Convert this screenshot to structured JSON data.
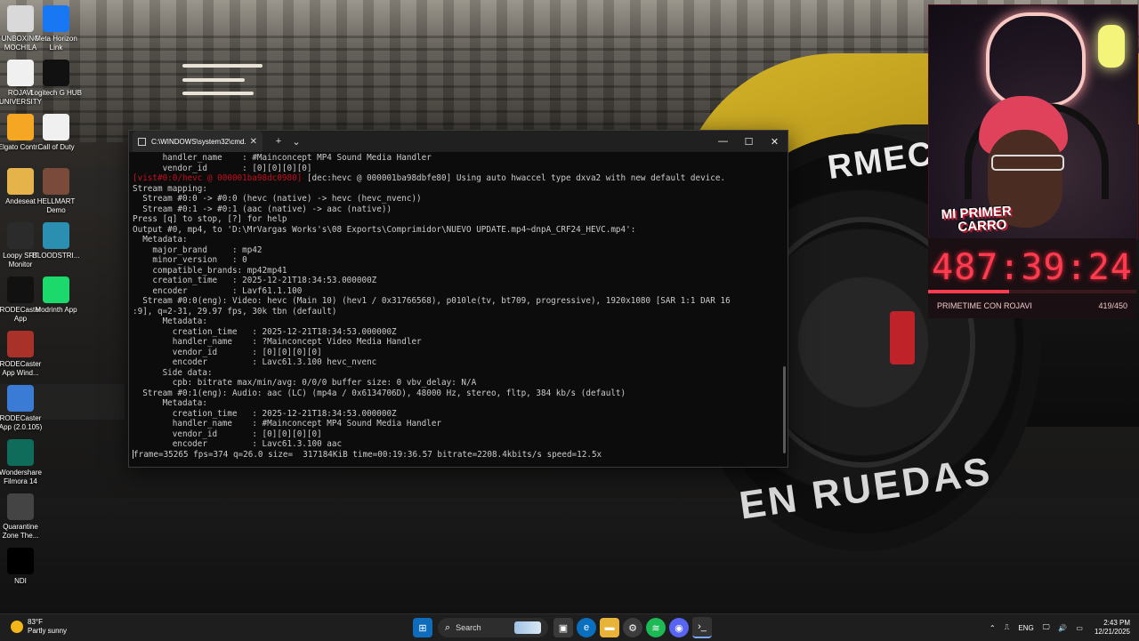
{
  "desktop_icons": [
    {
      "label": "UNBOXING MOCHILA",
      "icon": "folder-icon",
      "color": "#d9d9d9"
    },
    {
      "label": "Meta Horizon Link",
      "icon": "meta-icon",
      "color": "#1877f2"
    },
    {
      "label": "ROJAVI UNIVERSITY",
      "icon": "document-icon",
      "color": "#f0f0f0"
    },
    {
      "label": "Logitech G HUB",
      "icon": "logitech-icon",
      "color": "#111111"
    },
    {
      "label": "Elgato Contr...",
      "icon": "elgato-icon",
      "color": "#f5a623"
    },
    {
      "label": "Call of Duty",
      "icon": "document-icon",
      "color": "#f0f0f0"
    },
    {
      "label": "Andeseat",
      "icon": "folder-icon",
      "color": "#e6b34a"
    },
    {
      "label": "HELLMART Demo",
      "icon": "game-icon",
      "color": "#7a4a3a"
    },
    {
      "label": "Loopy SRT Monitor",
      "icon": "srt-icon",
      "color": "#2b2b2b"
    },
    {
      "label": "BLOODSTRI...",
      "icon": "game-icon",
      "color": "#2a8fb0"
    },
    {
      "label": "RODECaster App",
      "icon": "rode-icon",
      "color": "#111111"
    },
    {
      "label": "Modrinth App",
      "icon": "modrinth-icon",
      "color": "#1bd96a"
    },
    {
      "label": "RODECaster App Wind...",
      "icon": "winrar-icon",
      "color": "#a8322a"
    },
    {
      "label": "RODECaster App (2.0.105)",
      "icon": "installer-icon",
      "color": "#3a7bd5"
    },
    {
      "label": "Wondershare Filmora 14",
      "icon": "filmora-icon",
      "color": "#0f6b5a"
    },
    {
      "label": "Quarantine Zone The...",
      "icon": "game-icon",
      "color": "#444444"
    },
    {
      "label": "NDI",
      "icon": "ndi-icon",
      "color": "#000000"
    }
  ],
  "terminal": {
    "tab_title": "C:\\WINDOWS\\system32\\cmd.",
    "lines": [
      {
        "text": "      handler_name    : #Mainconcept MP4 Sound Media Handler",
        "red_prefix": ""
      },
      {
        "text": "      vendor_id       : [0][0][0][0]",
        "red_prefix": ""
      },
      {
        "text": " [dec:hevc @ 000001ba98dbfe80] Using auto hwaccel type dxva2 with new default device.",
        "red_prefix": "[vist#0:0/hevc @ 000001ba98dc0980]"
      },
      {
        "text": "Stream mapping:",
        "red_prefix": ""
      },
      {
        "text": "  Stream #0:0 -> #0:0 (hevc (native) -> hevc (hevc_nvenc))",
        "red_prefix": ""
      },
      {
        "text": "  Stream #0:1 -> #0:1 (aac (native) -> aac (native))",
        "red_prefix": ""
      },
      {
        "text": "Press [q] to stop, [?] for help",
        "red_prefix": ""
      },
      {
        "text": "Output #0, mp4, to 'D:\\MrVargas Works's\\08 Exports\\Comprimidor\\NUEVO UPDATE.mp4~dnpA_CRF24_HEVC.mp4':",
        "red_prefix": ""
      },
      {
        "text": "  Metadata:",
        "red_prefix": ""
      },
      {
        "text": "    major_brand     : mp42",
        "red_prefix": ""
      },
      {
        "text": "    minor_version   : 0",
        "red_prefix": ""
      },
      {
        "text": "    compatible_brands: mp42mp41",
        "red_prefix": ""
      },
      {
        "text": "    creation_time   : 2025-12-21T18:34:53.000000Z",
        "red_prefix": ""
      },
      {
        "text": "    encoder         : Lavf61.1.100",
        "red_prefix": ""
      },
      {
        "text": "  Stream #0:0(eng): Video: hevc (Main 10) (hev1 / 0x31766568), p010le(tv, bt709, progressive), 1920x1080 [SAR 1:1 DAR 16",
        "red_prefix": ""
      },
      {
        "text": ":9], q=2-31, 29.97 fps, 30k tbn (default)",
        "red_prefix": ""
      },
      {
        "text": "      Metadata:",
        "red_prefix": ""
      },
      {
        "text": "        creation_time   : 2025-12-21T18:34:53.000000Z",
        "red_prefix": ""
      },
      {
        "text": "        handler_name    : ?Mainconcept Video Media Handler",
        "red_prefix": ""
      },
      {
        "text": "        vendor_id       : [0][0][0][0]",
        "red_prefix": ""
      },
      {
        "text": "        encoder         : Lavc61.3.100 hevc_nvenc",
        "red_prefix": ""
      },
      {
        "text": "      Side data:",
        "red_prefix": ""
      },
      {
        "text": "        cpb: bitrate max/min/avg: 0/0/0 buffer size: 0 vbv_delay: N/A",
        "red_prefix": ""
      },
      {
        "text": "  Stream #0:1(eng): Audio: aac (LC) (mp4a / 0x6134706D), 48000 Hz, stereo, fltp, 384 kb/s (default)",
        "red_prefix": ""
      },
      {
        "text": "      Metadata:",
        "red_prefix": ""
      },
      {
        "text": "        creation_time   : 2025-12-21T18:34:53.000000Z",
        "red_prefix": ""
      },
      {
        "text": "        handler_name    : #Mainconcept MP4 Sound Media Handler",
        "red_prefix": ""
      },
      {
        "text": "        vendor_id       : [0][0][0][0]",
        "red_prefix": ""
      },
      {
        "text": "        encoder         : Lavc61.3.100 aac",
        "red_prefix": ""
      }
    ],
    "progress_line": "frame=35265 fps=374 q=26.0 size=  317184KiB time=00:19:36.57 bitrate=2208.4kbits/s speed=12.5x"
  },
  "wallpaper": {
    "tire_text_top": "RMEC",
    "tire_text_bottom": "EN RUEDAS"
  },
  "stream_overlay": {
    "logo_line1": "MI PRIMER",
    "logo_line2": "CARRO",
    "countdown": "487:39:24",
    "caption": "PRIMETIME CON ROJAVI",
    "count": "419/450",
    "progress_fraction": 0.39
  },
  "taskbar": {
    "weather_temp": "83°F",
    "weather_desc": "Partly sunny",
    "search_label": "Search",
    "language": "ENG",
    "time": "2:43 PM",
    "date": "12/21/2025"
  }
}
